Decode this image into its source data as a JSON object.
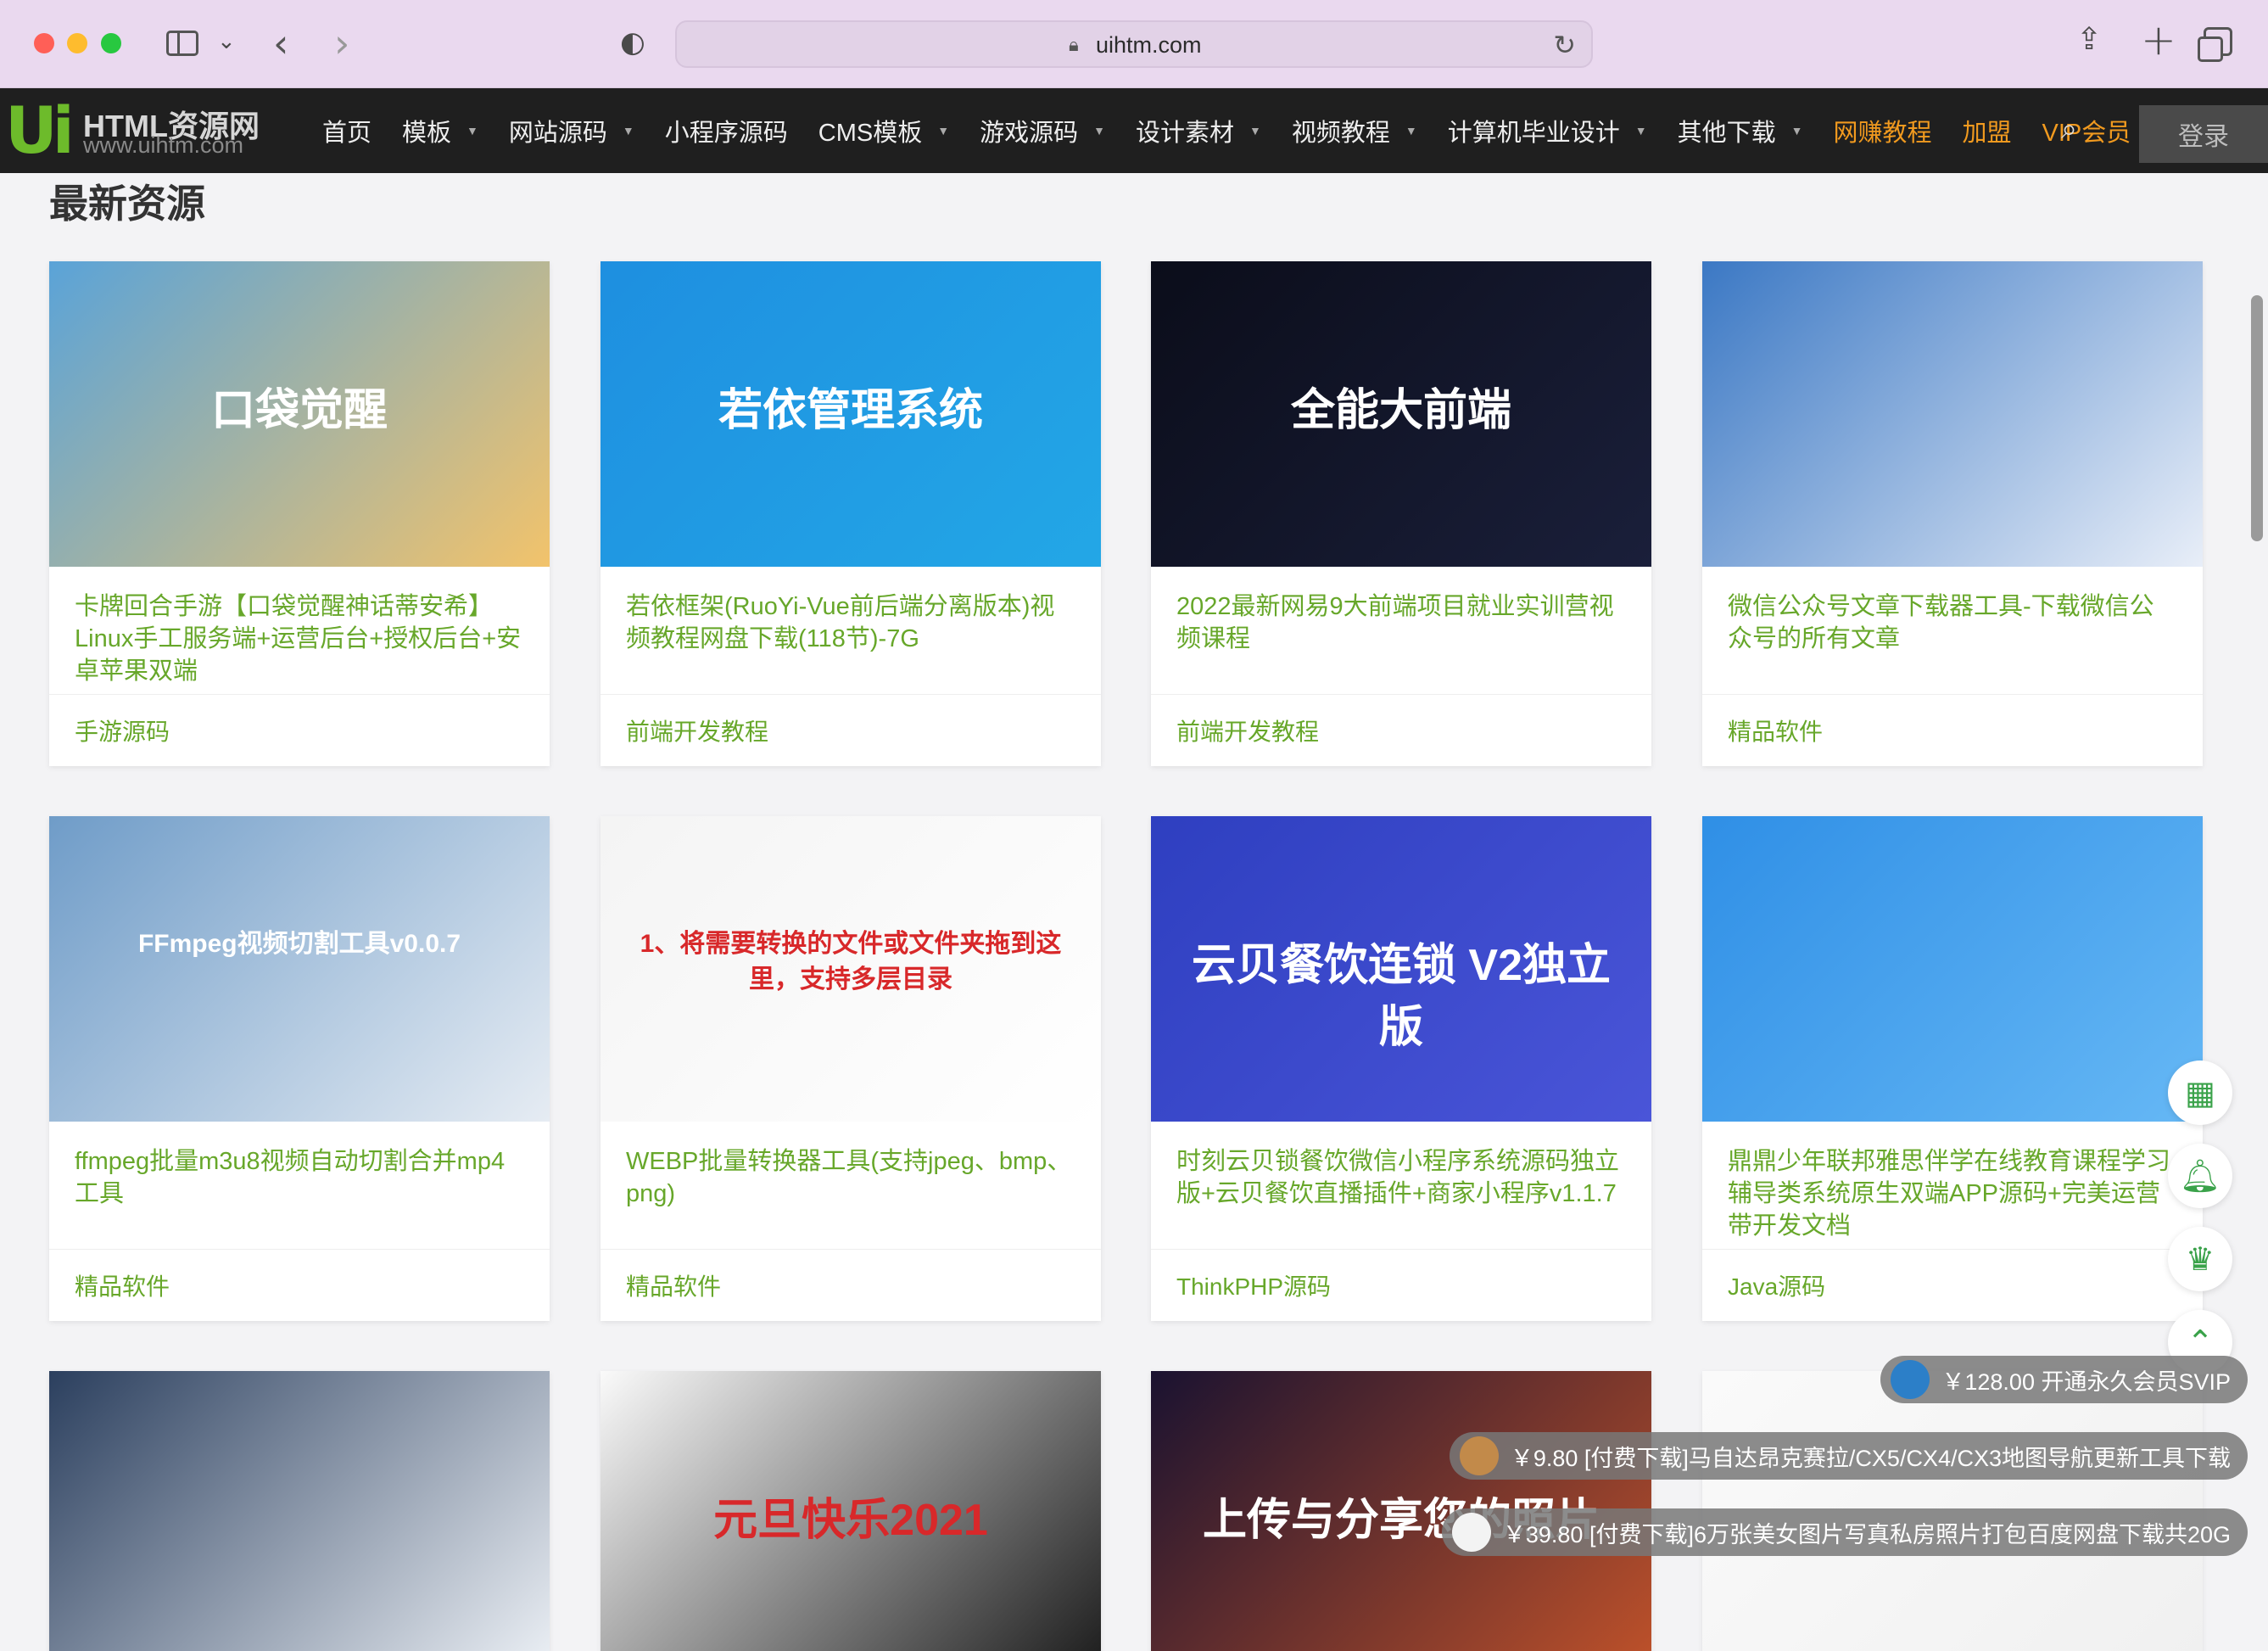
{
  "browser": {
    "url": "uihtm.com"
  },
  "site": {
    "logo_name": "HTML资源网",
    "logo_domain": "www.uihtm.com",
    "logo_mark": "Ui",
    "nav": [
      {
        "label": "首页",
        "dropdown": false,
        "hot": false
      },
      {
        "label": "模板",
        "dropdown": true,
        "hot": false
      },
      {
        "label": "网站源码",
        "dropdown": true,
        "hot": false
      },
      {
        "label": "小程序源码",
        "dropdown": false,
        "hot": false
      },
      {
        "label": "CMS模板",
        "dropdown": true,
        "hot": false
      },
      {
        "label": "游戏源码",
        "dropdown": true,
        "hot": false
      },
      {
        "label": "设计素材",
        "dropdown": true,
        "hot": false
      },
      {
        "label": "视频教程",
        "dropdown": true,
        "hot": false
      },
      {
        "label": "计算机毕业设计",
        "dropdown": true,
        "hot": false
      },
      {
        "label": "其他下载",
        "dropdown": true,
        "hot": false
      },
      {
        "label": "网赚教程",
        "dropdown": false,
        "hot": true
      },
      {
        "label": "加盟",
        "dropdown": false,
        "hot": true
      },
      {
        "label": "VIP会员",
        "dropdown": false,
        "hot": true
      }
    ],
    "login_label": "登录"
  },
  "main": {
    "section_title": "最新资源",
    "cards": [
      {
        "title": "卡牌回合手游【口袋觉醒神话蒂安希】Linux手工服务端+运营后台+授权后台+安卓苹果双端",
        "category": "手游源码",
        "thumb_text": "口袋觉醒",
        "thumb_colors": [
          "#5aa3d8",
          "#f2c36b"
        ]
      },
      {
        "title": "若依框架(RuoYi-Vue前后端分离版本)视频教程网盘下载(118节)-7G",
        "category": "前端开发教程",
        "thumb_text": "若依管理系统",
        "thumb_colors": [
          "#1e8fe0",
          "#23a7e6"
        ]
      },
      {
        "title": "2022最新网易9大前端项目就业实训营视频课程",
        "category": "前端开发教程",
        "thumb_text": "全能大前端",
        "thumb_colors": [
          "#0b0d1a",
          "#1a1f3a"
        ]
      },
      {
        "title": "微信公众号文章下载器工具-下载微信公众号的所有文章",
        "category": "精品软件",
        "thumb_text": "",
        "thumb_colors": [
          "#3b78c4",
          "#e8eef8"
        ]
      },
      {
        "title": "ffmpeg批量m3u8视频自动切割合并mp4工具",
        "category": "精品软件",
        "thumb_text": "FFmpeg视频切割工具v0.0.7",
        "thumb_colors": [
          "#6f9cc8",
          "#e6ecf3"
        ]
      },
      {
        "title": "WEBP批量转换器工具(支持jpeg、bmp、png)",
        "category": "精品软件",
        "thumb_text": "1、将需要转换的文件或文件夹拖到这里，支持多层目录",
        "thumb_colors": [
          "#f4f4f4",
          "#ffffff"
        ]
      },
      {
        "title": "时刻云贝锁餐饮微信小程序系统源码独立版+云贝餐饮直播插件+商家小程序v1.1.7",
        "category": "ThinkPHP源码",
        "thumb_text": "云贝餐饮连锁 V2独立版",
        "thumb_colors": [
          "#2e3fc0",
          "#4a55d8"
        ]
      },
      {
        "title": "鼎鼎少年联邦雅思伴学在线教育课程学习辅导类系统原生双端APP源码+完美运营带开发文档",
        "category": "Java源码",
        "thumb_text": "",
        "thumb_colors": [
          "#2f8fe6",
          "#66b8f5"
        ]
      },
      {
        "title": "",
        "category": "",
        "thumb_text": "",
        "thumb_colors": [
          "#2b3f5e",
          "#eef2f7"
        ]
      },
      {
        "title": "",
        "category": "",
        "thumb_text": "元旦快乐2021",
        "thumb_colors": [
          "#fafafa",
          "#1a1a1a"
        ]
      },
      {
        "title": "",
        "category": "",
        "thumb_text": "上传与分享您的照片",
        "thumb_colors": [
          "#1a1230",
          "#c0522a"
        ]
      },
      {
        "title": "",
        "category": "",
        "thumb_text": "",
        "thumb_colors": [
          "#fafafa",
          "#f0f0f0"
        ]
      }
    ]
  },
  "toasts": [
    {
      "text": "￥128.00 开通永久会员SVIP",
      "avatar_color": "#2c7fc8"
    },
    {
      "text": "￥9.80 [付费下载]马自达昂克赛拉/CX5/CX4/CX3地图导航更新工具下载",
      "avatar_color": "#c28a4a"
    },
    {
      "text": "￥39.80 [付费下载]6万张美女图片写真私房照片打包百度网盘下载共20G",
      "avatar_color": "#f3f3f3"
    }
  ],
  "colors": {
    "accent_green": "#67a72a",
    "nav_bg": "#1f1f1f",
    "hot_orange": "#f19a1f"
  }
}
